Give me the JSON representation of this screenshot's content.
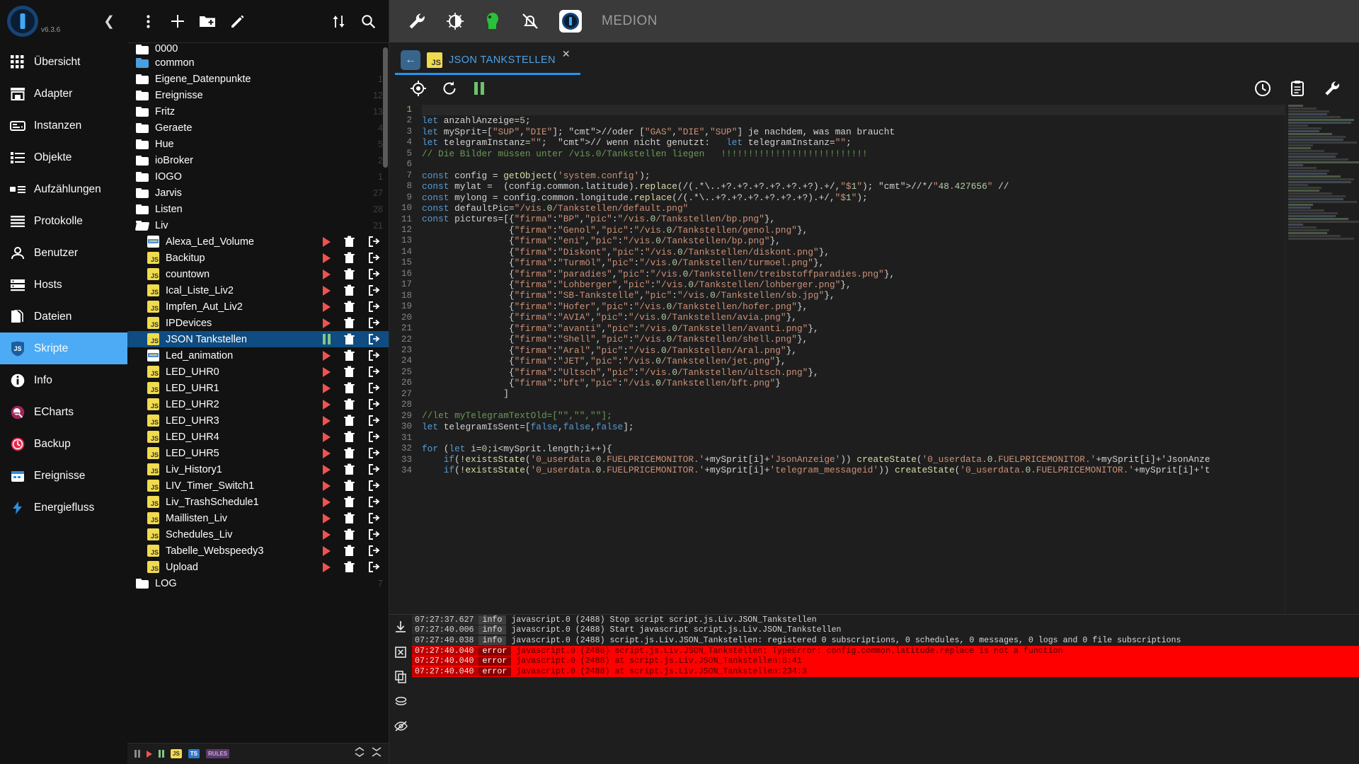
{
  "sidebar": {
    "version": "v6.3.6",
    "collapse_icon": "chevron-left-icon",
    "items": [
      {
        "label": "Übersicht",
        "icon": "grid-icon",
        "active": false
      },
      {
        "label": "Adapter",
        "icon": "store-icon",
        "active": false
      },
      {
        "label": "Instanzen",
        "icon": "instances-icon",
        "active": false
      },
      {
        "label": "Objekte",
        "icon": "list-icon",
        "active": false
      },
      {
        "label": "Aufzählungen",
        "icon": "enums-icon",
        "active": false
      },
      {
        "label": "Protokolle",
        "icon": "logs-icon",
        "active": false
      },
      {
        "label": "Benutzer",
        "icon": "user-icon",
        "active": false
      },
      {
        "label": "Hosts",
        "icon": "hosts-icon",
        "active": false
      },
      {
        "label": "Dateien",
        "icon": "files-icon",
        "active": false
      },
      {
        "label": "Skripte",
        "icon": "js-shield-icon",
        "active": true
      },
      {
        "label": "Info",
        "icon": "info-icon",
        "active": false
      },
      {
        "label": "ECharts",
        "icon": "echarts-icon",
        "active": false
      },
      {
        "label": "Backup",
        "icon": "backup-icon",
        "active": false
      },
      {
        "label": "Ereignisse",
        "icon": "events-icon",
        "active": false
      },
      {
        "label": "Energiefluss",
        "icon": "energy-icon",
        "active": false
      }
    ]
  },
  "topbar": {
    "icons": [
      "wrench-icon",
      "brightness-icon",
      "green-person-icon",
      "bell-off-icon"
    ],
    "brand": "MEDION",
    "brand_logo": "iobroker-logo-icon"
  },
  "tree_toolbar": {
    "icons": [
      "more-vert-icon",
      "add-icon",
      "new-folder-icon",
      "edit-icon"
    ],
    "right_icons": [
      "sort-icon",
      "search-icon"
    ]
  },
  "tree": {
    "folders_top": [
      {
        "name": "0000",
        "count": "",
        "cut": true,
        "blue": false
      },
      {
        "name": "common",
        "count": "",
        "blue": true
      },
      {
        "name": "Eigene_Datenpunkte",
        "count": "1"
      },
      {
        "name": "Ereignisse",
        "count": "12"
      },
      {
        "name": "Fritz",
        "count": "13"
      },
      {
        "name": "Geraete",
        "count": "4"
      },
      {
        "name": "Hue",
        "count": "5"
      },
      {
        "name": "ioBroker",
        "count": "2"
      },
      {
        "name": "IOGO",
        "count": "1"
      },
      {
        "name": "Jarvis",
        "count": "27"
      },
      {
        "name": "Listen",
        "count": "28"
      }
    ],
    "open_folder": {
      "name": "Liv",
      "count": "21"
    },
    "scripts": [
      {
        "name": "Alexa_Led_Volume",
        "type": "blockly",
        "state": "stopped"
      },
      {
        "name": "Backitup",
        "type": "js",
        "state": "stopped"
      },
      {
        "name": "countown",
        "type": "js",
        "state": "stopped"
      },
      {
        "name": "Ical_Liste_Liv2",
        "type": "js",
        "state": "stopped"
      },
      {
        "name": "Impfen_Aut_Liv2",
        "type": "js",
        "state": "stopped"
      },
      {
        "name": "IPDevices",
        "type": "js",
        "state": "stopped"
      },
      {
        "name": "JSON Tankstellen",
        "type": "js",
        "state": "running",
        "selected": true
      },
      {
        "name": "Led_animation",
        "type": "blockly",
        "state": "stopped"
      },
      {
        "name": "LED_UHR0",
        "type": "js",
        "state": "stopped"
      },
      {
        "name": "LED_UHR1",
        "type": "js",
        "state": "stopped"
      },
      {
        "name": "LED_UHR2",
        "type": "js",
        "state": "stopped"
      },
      {
        "name": "LED_UHR3",
        "type": "js",
        "state": "stopped"
      },
      {
        "name": "LED_UHR4",
        "type": "js",
        "state": "stopped"
      },
      {
        "name": "LED_UHR5",
        "type": "js",
        "state": "stopped"
      },
      {
        "name": "Liv_History1",
        "type": "js",
        "state": "stopped"
      },
      {
        "name": "LIV_Timer_Switch1",
        "type": "js",
        "state": "stopped"
      },
      {
        "name": "Liv_TrashSchedule1",
        "type": "js",
        "state": "stopped"
      },
      {
        "name": "Maillisten_Liv",
        "type": "js",
        "state": "stopped"
      },
      {
        "name": "Schedules_Liv",
        "type": "js",
        "state": "stopped"
      },
      {
        "name": "Tabelle_Webspeedy3",
        "type": "js",
        "state": "stopped"
      },
      {
        "name": "Upload",
        "type": "js",
        "state": "stopped"
      }
    ],
    "folders_bottom": [
      {
        "name": "LOG",
        "count": "7",
        "cut": true
      }
    ],
    "bottom_bar": {
      "chips": [
        "JS",
        "TS",
        "RULES"
      ],
      "right_icons": [
        "expand-icon",
        "collapse-icon"
      ]
    }
  },
  "tab": {
    "back_icon": "arrow-left-icon",
    "icon": "js-icon",
    "title": "JSON TANKSTELLEN",
    "close_icon": "close-icon"
  },
  "editor_toolbar": {
    "left": [
      "locate-icon",
      "restart-icon",
      "pause-icon"
    ],
    "right": [
      "history-icon",
      "clipboard-icon",
      "settings-wrench-icon"
    ]
  },
  "code": {
    "start_line": 1,
    "lines": [
      {
        "n": 1,
        "t": ""
      },
      {
        "n": 2,
        "t": "let anzahlAnzeige=5;"
      },
      {
        "n": 3,
        "t": "let mySprit=[\"SUP\",\"DIE\"]; //oder [\"GAS\",\"DIE\",\"SUP\"] je nachdem, was man braucht"
      },
      {
        "n": 4,
        "t": "let telegramInstanz=\"\";  // wenn nicht genutzt:   let telegramInstanz=\"\";"
      },
      {
        "n": 5,
        "t": "// Die Bilder müssen unter /vis.0/Tankstellen liegen   !!!!!!!!!!!!!!!!!!!!!!!!!!!"
      },
      {
        "n": 6,
        "t": ""
      },
      {
        "n": 7,
        "t": "const config = getObject('system.config');"
      },
      {
        "n": 8,
        "t": "const mylat =  (config.common.latitude).replace(/(.*\\..+?.+?.+?.+?.+?.+?).+/,\"$1\"); //*/\"48.427656\" //"
      },
      {
        "n": 9,
        "t": "const mylong = config.common.longitude.replace(/(.*\\..+?.+?.+?.+?.+?.+?).+/,\"$1\");"
      },
      {
        "n": 10,
        "t": "const defaultPic=\"/vis.0/Tankstellen/default.png\""
      },
      {
        "n": 11,
        "t": "const pictures=[{\"firma\":\"BP\",\"pic\":\"/vis.0/Tankstellen/bp.png\"},"
      },
      {
        "n": 12,
        "t": "                {\"firma\":\"Genol\",\"pic\":\"/vis.0/Tankstellen/genol.png\"},"
      },
      {
        "n": 13,
        "t": "                {\"firma\":\"eni\",\"pic\":\"/vis.0/Tankstellen/bp.png\"},"
      },
      {
        "n": 14,
        "t": "                {\"firma\":\"Diskont\",\"pic\":\"/vis.0/Tankstellen/diskont.png\"},"
      },
      {
        "n": 15,
        "t": "                {\"firma\":\"Turmöl\",\"pic\":\"/vis.0/Tankstellen/turmoel.png\"},"
      },
      {
        "n": 16,
        "t": "                {\"firma\":\"paradies\",\"pic\":\"/vis.0/Tankstellen/treibstoffparadies.png\"},"
      },
      {
        "n": 17,
        "t": "                {\"firma\":\"Lohberger\",\"pic\":\"/vis.0/Tankstellen/lohberger.png\"},"
      },
      {
        "n": 18,
        "t": "                {\"firma\":\"SB-Tankstelle\",\"pic\":\"/vis.0/Tankstellen/sb.jpg\"},"
      },
      {
        "n": 19,
        "t": "                {\"firma\":\"Hofer\",\"pic\":\"/vis.0/Tankstellen/hofer.png\"},"
      },
      {
        "n": 20,
        "t": "                {\"firma\":\"AVIA\",\"pic\":\"/vis.0/Tankstellen/avia.png\"},"
      },
      {
        "n": 21,
        "t": "                {\"firma\":\"avanti\",\"pic\":\"/vis.0/Tankstellen/avanti.png\"},"
      },
      {
        "n": 22,
        "t": "                {\"firma\":\"Shell\",\"pic\":\"/vis.0/Tankstellen/shell.png\"},"
      },
      {
        "n": 23,
        "t": "                {\"firma\":\"Aral\",\"pic\":\"/vis.0/Tankstellen/Aral.png\"},"
      },
      {
        "n": 24,
        "t": "                {\"firma\":\"JET\",\"pic\":\"/vis.0/Tankstellen/jet.png\"},"
      },
      {
        "n": 25,
        "t": "                {\"firma\":\"Ultsch\",\"pic\":\"/vis.0/Tankstellen/ultsch.png\"},"
      },
      {
        "n": 26,
        "t": "                {\"firma\":\"bft\",\"pic\":\"/vis.0/Tankstellen/bft.png\"}"
      },
      {
        "n": 27,
        "t": "               ]"
      },
      {
        "n": 28,
        "t": ""
      },
      {
        "n": 29,
        "t": "//let myTelegramTextOld=[\"\",\"\",\"\"];"
      },
      {
        "n": 30,
        "t": "let telegramIsSent=[false,false,false];"
      },
      {
        "n": 31,
        "t": ""
      },
      {
        "n": 32,
        "t": "for (let i=0;i<mySprit.length;i++){"
      },
      {
        "n": 33,
        "t": "    if(!existsState('0_userdata.0.FUELPRICEMONITOR.'+mySprit[i]+'JsonAnzeige')) createState('0_userdata.0.FUELPRICEMONITOR.'+mySprit[i]+'JsonAnze"
      },
      {
        "n": 34,
        "t": "    if(!existsState('0_userdata.0.FUELPRICEMONITOR.'+mySprit[i]+'telegram_messageid')) createState('0_userdata.0.FUELPRICEMONITOR.'+mySprit[i]+'t"
      }
    ]
  },
  "log": {
    "side_icons": [
      "download-icon",
      "clear-icon",
      "copy-icon",
      "layers-icon",
      "eye-off-icon"
    ],
    "rows": [
      {
        "ts": "07:27:37.627",
        "level": "info",
        "msg": "javascript.0 (2488) Stop script script.js.Liv.JSON_Tankstellen"
      },
      {
        "ts": "07:27:40.006",
        "level": "info",
        "msg": "javascript.0 (2488) Start javascript script.js.Liv.JSON_Tankstellen"
      },
      {
        "ts": "07:27:40.038",
        "level": "info",
        "msg": "javascript.0 (2488) script.js.Liv.JSON_Tankstellen: registered 0 subscriptions, 0 schedules, 0 messages, 0 logs and 0 file subscriptions"
      },
      {
        "ts": "07:27:40.040",
        "level": "error",
        "msg": "javascript.0 (2488) script.js.Liv.JSON_Tankstellen: TypeError: config.common.latitude.replace is not a function"
      },
      {
        "ts": "07:27:40.040",
        "level": "error",
        "msg": "javascript.0 (2488) at script.js.Liv.JSON_Tankstellen:8:41"
      },
      {
        "ts": "07:27:40.040",
        "level": "error",
        "msg": "javascript.0 (2488) at script.js.Liv.JSON_Tankstellen:234:3"
      }
    ]
  }
}
